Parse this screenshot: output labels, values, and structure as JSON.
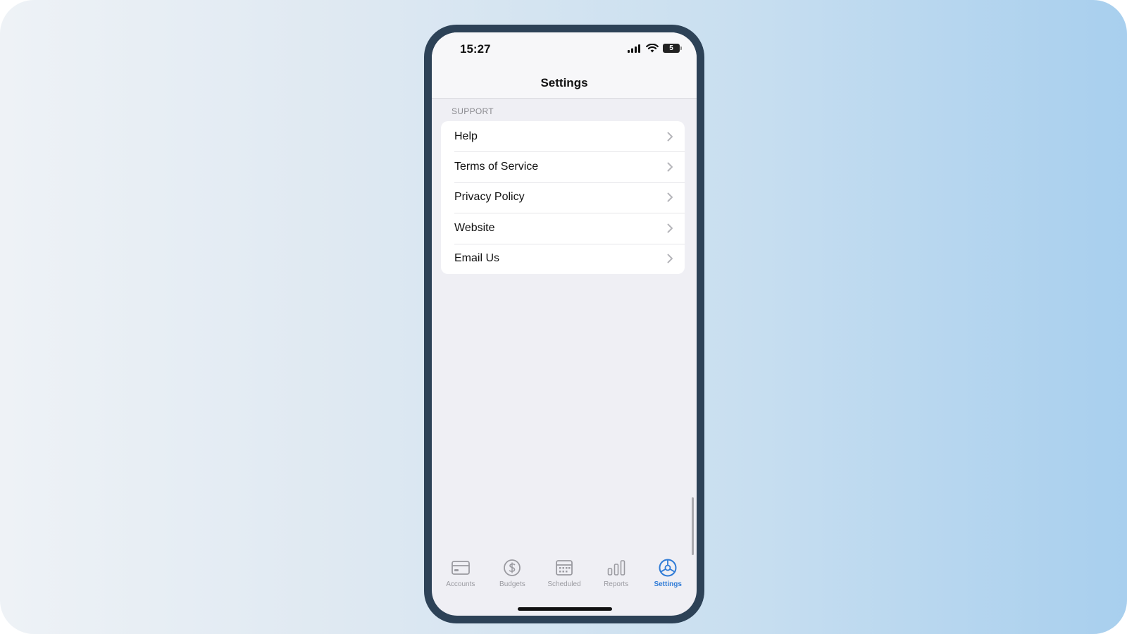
{
  "status_bar": {
    "time": "15:27",
    "battery_level": "5"
  },
  "nav": {
    "title": "Settings"
  },
  "section": {
    "header": "SUPPORT"
  },
  "items": [
    {
      "label": "Help"
    },
    {
      "label": "Terms of Service"
    },
    {
      "label": "Privacy Policy"
    },
    {
      "label": "Website"
    },
    {
      "label": "Email Us"
    }
  ],
  "tabs": [
    {
      "label": "Accounts",
      "icon": "card-icon",
      "active": false
    },
    {
      "label": "Budgets",
      "icon": "dollar-circle-icon",
      "active": false
    },
    {
      "label": "Scheduled",
      "icon": "calendar-icon",
      "active": false
    },
    {
      "label": "Reports",
      "icon": "bar-chart-icon",
      "active": false
    },
    {
      "label": "Settings",
      "icon": "settings-icon",
      "active": true
    }
  ],
  "colors": {
    "accent": "#2f7bd6",
    "phone_frame": "#2d4257",
    "screen_bg": "#efeff4"
  }
}
